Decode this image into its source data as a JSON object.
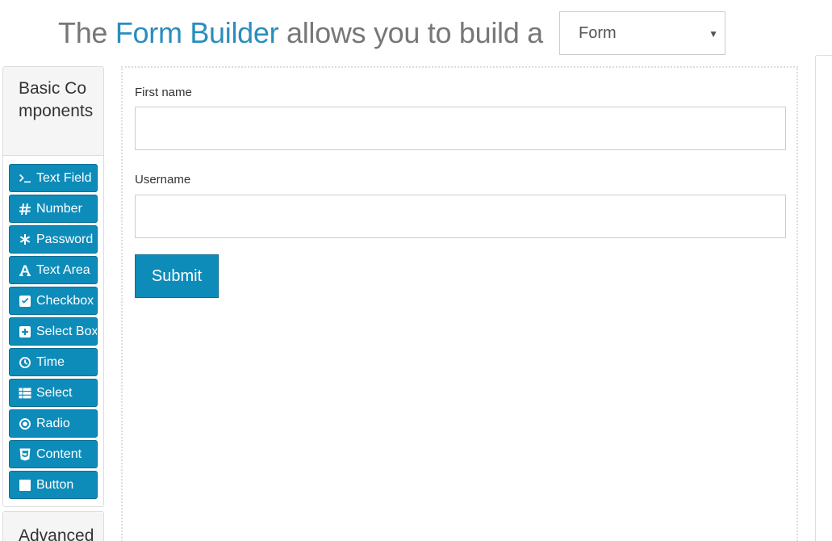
{
  "header": {
    "prefix": "The ",
    "brand": "Form Builder",
    "suffix": " allows you to build a",
    "type_select": {
      "value": "Form"
    }
  },
  "sidebar": {
    "basic_title": "Basic Components",
    "basic_components": [
      {
        "label": "Text Field",
        "icon": "terminal-icon"
      },
      {
        "label": "Number",
        "icon": "hashtag-icon"
      },
      {
        "label": "Password",
        "icon": "asterisk-icon"
      },
      {
        "label": "Text Area",
        "icon": "font-icon"
      },
      {
        "label": "Checkbox",
        "icon": "check-square-icon"
      },
      {
        "label": "Select Boxes",
        "icon": "plus-square-icon"
      },
      {
        "label": "Time",
        "icon": "clock-icon"
      },
      {
        "label": "Select",
        "icon": "th-list-icon"
      },
      {
        "label": "Radio",
        "icon": "dot-circle-icon"
      },
      {
        "label": "Content",
        "icon": "html5-icon"
      },
      {
        "label": "Button",
        "icon": "stop-icon"
      }
    ],
    "advanced_title": "Advanced"
  },
  "form": {
    "fields": [
      {
        "label": "First name",
        "value": ""
      },
      {
        "label": "Username",
        "value": ""
      }
    ],
    "submit_label": "Submit"
  },
  "colors": {
    "accent": "#0e8cb9",
    "brand_text": "#2a8dbf",
    "header_text": "#777777"
  }
}
